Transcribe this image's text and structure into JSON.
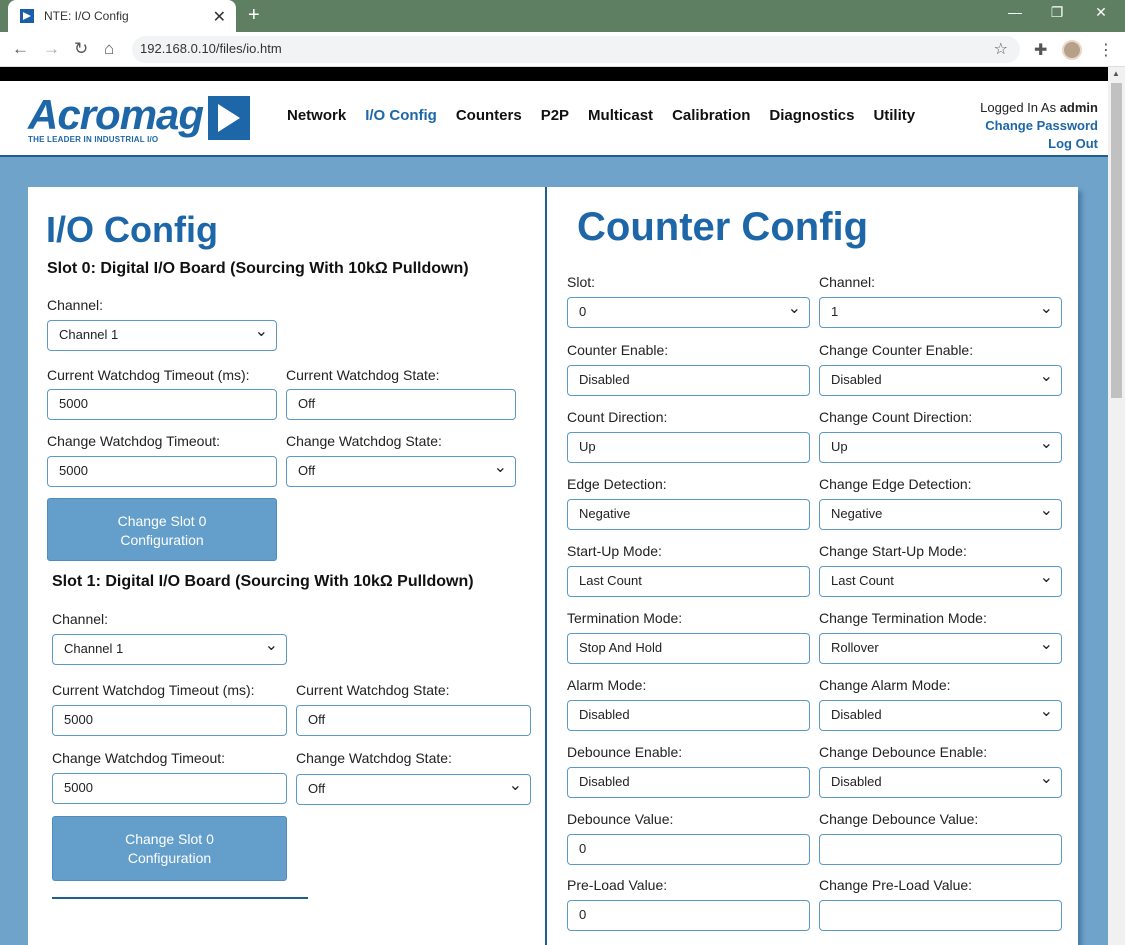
{
  "browser": {
    "tab_title": "NTE: I/O Config",
    "url": "192.168.0.10/files/io.htm"
  },
  "header": {
    "logo_wordmark": "Acromag",
    "logo_tagline": "THE LEADER IN INDUSTRIAL I/O",
    "nav": [
      {
        "label": "Network",
        "active": false
      },
      {
        "label": "I/O Config",
        "active": true
      },
      {
        "label": "Counters",
        "active": false
      },
      {
        "label": "P2P",
        "active": false
      },
      {
        "label": "Multicast",
        "active": false
      },
      {
        "label": "Calibration",
        "active": false
      },
      {
        "label": "Diagnostics",
        "active": false
      },
      {
        "label": "Utility",
        "active": false
      }
    ],
    "logged_in_label": "Logged In As",
    "username": "admin",
    "change_password": "Change Password",
    "log_out": "Log Out"
  },
  "io_config": {
    "title": "I/O Config",
    "slots": [
      {
        "title": "Slot 0: Digital I/O Board (Sourcing With 10kΩ Pulldown)",
        "channel_label": "Channel:",
        "channel_value": "Channel 1",
        "current_timeout_label": "Current Watchdog Timeout (ms):",
        "current_timeout_value": "5000",
        "current_state_label": "Current Watchdog State:",
        "current_state_value": "Off",
        "change_timeout_label": "Change Watchdog Timeout:",
        "change_timeout_value": "5000",
        "change_state_label": "Change Watchdog State:",
        "change_state_value": "Off",
        "button_line1": "Change Slot 0",
        "button_line2": "Configuration"
      },
      {
        "title": "Slot 1: Digital I/O Board (Sourcing With 10kΩ Pulldown)",
        "channel_label": "Channel:",
        "channel_value": "Channel 1",
        "current_timeout_label": "Current Watchdog Timeout (ms):",
        "current_timeout_value": "5000",
        "current_state_label": "Current Watchdog State:",
        "current_state_value": "Off",
        "change_timeout_label": "Change Watchdog Timeout:",
        "change_timeout_value": "5000",
        "change_state_label": "Change Watchdog State:",
        "change_state_value": "Off",
        "button_line1": "Change Slot 0",
        "button_line2": "Configuration"
      }
    ]
  },
  "counter_config": {
    "title": "Counter Config",
    "slot_label": "Slot:",
    "slot_value": "0",
    "channel_label": "Channel:",
    "channel_value": "1",
    "rows": [
      {
        "current_label": "Counter Enable:",
        "current_value": "Disabled",
        "change_label": "Change Counter Enable:",
        "change_value": "Disabled",
        "change_is_select": true
      },
      {
        "current_label": "Count Direction:",
        "current_value": "Up",
        "change_label": "Change Count Direction:",
        "change_value": "Up",
        "change_is_select": true
      },
      {
        "current_label": "Edge Detection:",
        "current_value": "Negative",
        "change_label": "Change Edge Detection:",
        "change_value": "Negative",
        "change_is_select": true
      },
      {
        "current_label": "Start-Up Mode:",
        "current_value": "Last Count",
        "change_label": "Change Start-Up Mode:",
        "change_value": "Last Count",
        "change_is_select": true
      },
      {
        "current_label": "Termination Mode:",
        "current_value": "Stop And Hold",
        "change_label": "Change Termination Mode:",
        "change_value": "Rollover",
        "change_is_select": true
      },
      {
        "current_label": "Alarm Mode:",
        "current_value": "Disabled",
        "change_label": "Change Alarm Mode:",
        "change_value": "Disabled",
        "change_is_select": true
      },
      {
        "current_label": "Debounce Enable:",
        "current_value": "Disabled",
        "change_label": "Change Debounce Enable:",
        "change_value": "Disabled",
        "change_is_select": true
      },
      {
        "current_label": "Debounce Value:",
        "current_value": "0",
        "change_label": "Change Debounce Value:",
        "change_value": "",
        "change_is_select": false
      },
      {
        "current_label": "Pre-Load Value:",
        "current_value": "0",
        "change_label": "Change Pre-Load Value:",
        "change_value": "",
        "change_is_select": false
      }
    ]
  }
}
